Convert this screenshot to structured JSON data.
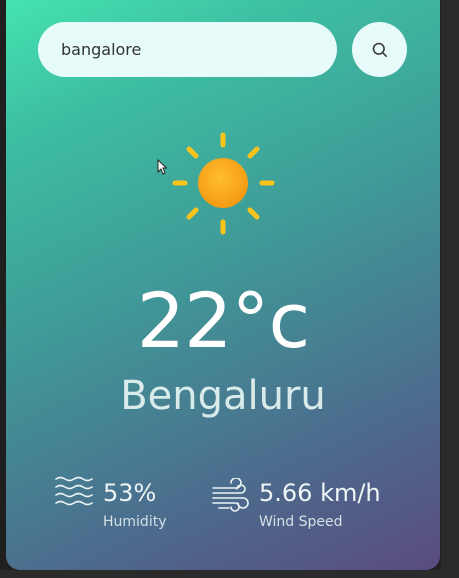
{
  "search": {
    "value": "bangalore",
    "icon": "search-icon"
  },
  "weather": {
    "icon": "sun-icon",
    "temperature": "22°c",
    "city": "Bengaluru"
  },
  "humidity": {
    "icon": "humidity-waves-icon",
    "value": "53%",
    "label": "Humidity"
  },
  "wind": {
    "icon": "wind-icon",
    "value": "5.66 km/h",
    "label": "Wind Speed"
  },
  "colors": {
    "gradient_start": "#45e3b0",
    "gradient_end": "#5a4b7f",
    "sun": "#f9a11b",
    "sun_rays": "#fcc419",
    "field_background": "#e8fbfb"
  }
}
